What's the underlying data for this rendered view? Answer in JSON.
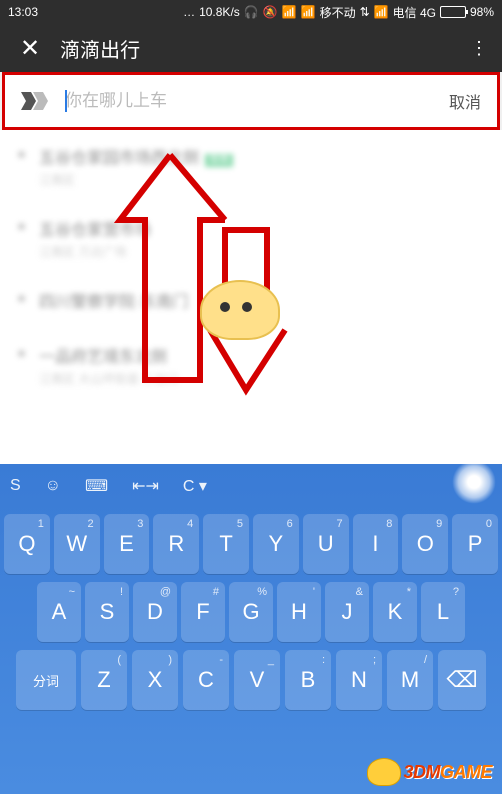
{
  "status": {
    "time": "13:03",
    "speed": "10.8K/s",
    "carrier1": "移不动",
    "carrier2": "电信 4G",
    "battery": "98%"
  },
  "header": {
    "close": "✕",
    "title": "滴滴出行",
    "menu": "⋮"
  },
  "search": {
    "placeholder": "你在哪儿上车",
    "value": "",
    "cancel": "取消"
  },
  "suggestions": [
    {
      "title": "五谷仓家园市场西北侧",
      "sub": "江南区",
      "badge": "常用"
    },
    {
      "title": "五谷仓家营市场",
      "sub": "江南区 万达广场",
      "badge": ""
    },
    {
      "title": "四川警察学院·东南门",
      "sub": "",
      "badge": ""
    },
    {
      "title": "一品府艺境东北侧",
      "sub": "江南区 大山坪街道·三岔口",
      "badge": ""
    }
  ],
  "keyboard": {
    "toolbar": [
      "S",
      "☺",
      "⌨",
      "⇤⇥",
      "C ▾"
    ],
    "row1": [
      {
        "k": "Q",
        "n": "1"
      },
      {
        "k": "W",
        "n": "2"
      },
      {
        "k": "E",
        "n": "3"
      },
      {
        "k": "R",
        "n": "4"
      },
      {
        "k": "T",
        "n": "5"
      },
      {
        "k": "Y",
        "n": "6"
      },
      {
        "k": "U",
        "n": "7"
      },
      {
        "k": "I",
        "n": "8"
      },
      {
        "k": "O",
        "n": "9"
      },
      {
        "k": "P",
        "n": "0"
      }
    ],
    "row2": [
      {
        "k": "A",
        "n": "~"
      },
      {
        "k": "S",
        "n": "!"
      },
      {
        "k": "D",
        "n": "@"
      },
      {
        "k": "F",
        "n": "#"
      },
      {
        "k": "G",
        "n": "%"
      },
      {
        "k": "H",
        "n": "'"
      },
      {
        "k": "J",
        "n": "&"
      },
      {
        "k": "K",
        "n": "*"
      },
      {
        "k": "L",
        "n": "?"
      }
    ],
    "row3": {
      "left": "分词",
      "keys": [
        {
          "k": "Z",
          "n": "("
        },
        {
          "k": "X",
          "n": ")"
        },
        {
          "k": "C",
          "n": "-"
        },
        {
          "k": "V",
          "n": "_"
        },
        {
          "k": "B",
          "n": ":"
        },
        {
          "k": "N",
          "n": ";"
        },
        {
          "k": "M",
          "n": "/"
        }
      ],
      "right": "⌫"
    }
  },
  "watermark": {
    "brand": "3DM",
    "suffix": "GAME"
  }
}
